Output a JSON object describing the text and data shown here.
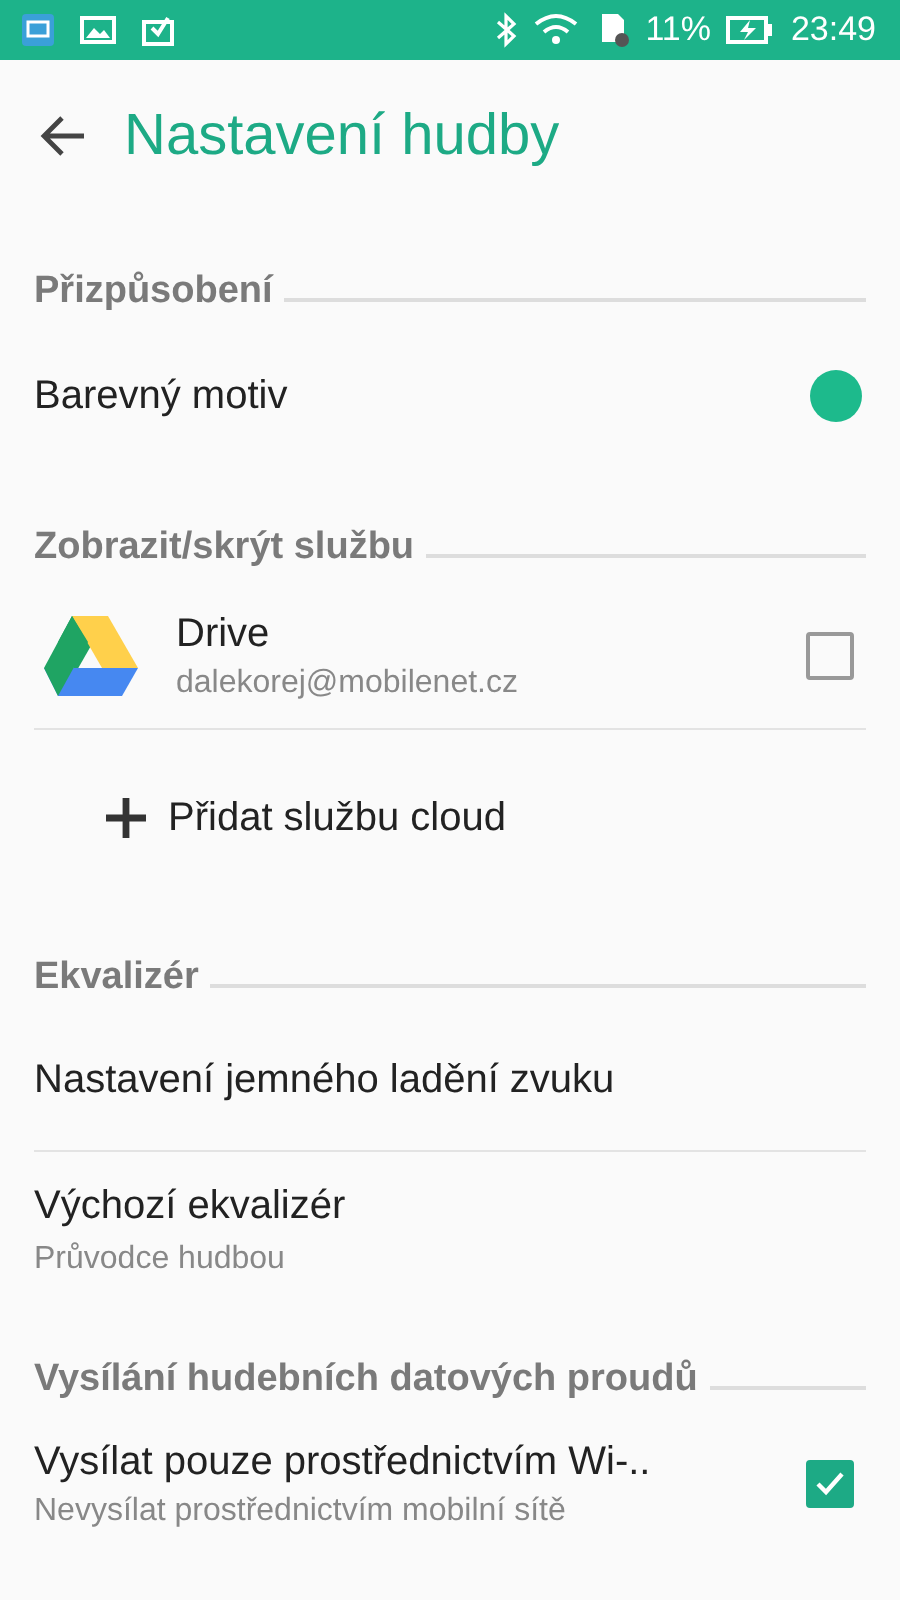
{
  "status_bar": {
    "battery": "11%",
    "time": "23:49"
  },
  "toolbar": {
    "title": "Nastavení hudby"
  },
  "sections": [
    {
      "title": "Přizpůsobení",
      "items": [
        {
          "kind": "color",
          "title": "Barevný motiv",
          "color": "#1dba8c"
        }
      ]
    },
    {
      "title": "Zobrazit/skrýt službu",
      "items": [
        {
          "kind": "account",
          "title": "Drive",
          "subtitle": "dalekorej@mobilenet.cz",
          "checked": false
        },
        {
          "kind": "action",
          "title": "Přidat službu cloud"
        }
      ]
    },
    {
      "title": "Ekvalizér",
      "items": [
        {
          "kind": "plain",
          "title": "Nastavení jemného ladění zvuku"
        },
        {
          "kind": "plain",
          "title": "Výchozí ekvalizér",
          "subtitle": "Průvodce hudbou"
        }
      ]
    },
    {
      "title": "Vysílání hudebních datových proudů",
      "items": [
        {
          "kind": "checkbox",
          "title": "Vysílat pouze prostřednictvím Wi-..",
          "subtitle": "Nevysílat prostřednictvím mobilní sítě",
          "checked": true
        }
      ]
    }
  ]
}
